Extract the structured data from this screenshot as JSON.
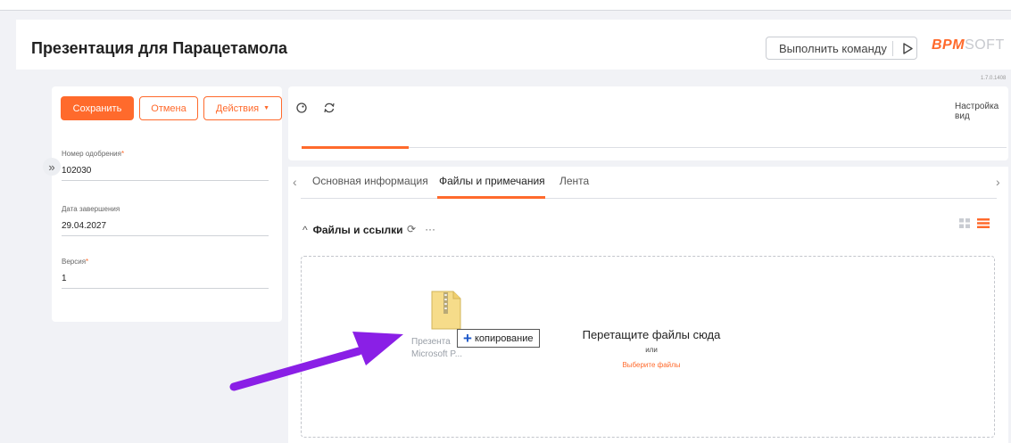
{
  "header": {
    "title": "Презентация для Парацетамола",
    "command_placeholder": "Выполнить команду",
    "logo_bpm": "BPM",
    "logo_soft": "SOFT",
    "version": "1.7.0.1408"
  },
  "toolbar": {
    "save_label": "Сохранить",
    "cancel_label": "Отмена",
    "actions_label": "Действия",
    "view_settings_label": "Настройка вид"
  },
  "fields": {
    "approval_number": {
      "label": "Номер одобрения",
      "required": "*",
      "value": "102030"
    },
    "end_date": {
      "label": "Дата завершения",
      "value": "29.04.2027"
    },
    "version": {
      "label": "Версия",
      "required": "*",
      "value": "1"
    }
  },
  "tabs": [
    {
      "label": "Основная информация",
      "active": false
    },
    {
      "label": "Файлы и примечания",
      "active": true
    },
    {
      "label": "Лента",
      "active": false
    }
  ],
  "files_section": {
    "title": "Файлы и ссылки",
    "drop_text": "Перетащите файлы сюда",
    "drop_or": "или",
    "drop_choose": "Выберите файлы"
  },
  "drag": {
    "file_name_line1": "Презента",
    "file_name_line2": "Microsoft P...",
    "copy_label": "копирование"
  },
  "colors": {
    "accent": "#ff6a2c",
    "annotation_arrow": "#8a1fe6"
  }
}
